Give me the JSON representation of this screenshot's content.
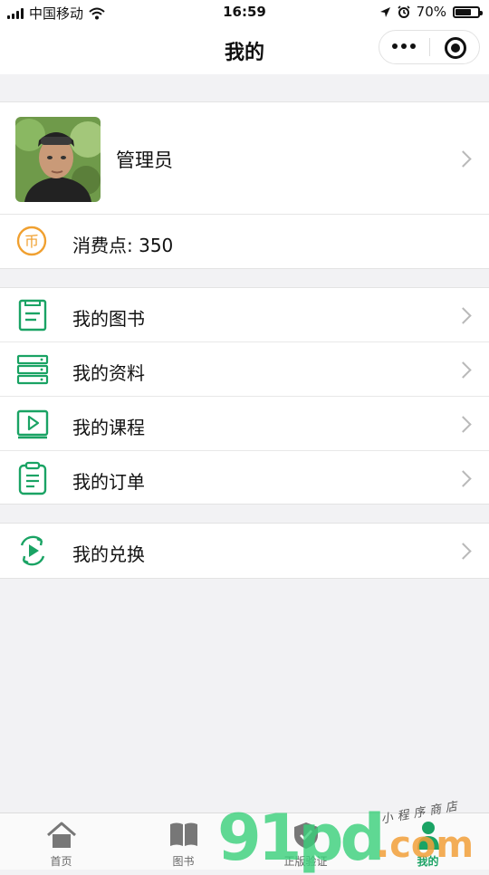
{
  "status_bar": {
    "carrier": "中国移动",
    "time": "16:59",
    "battery_percent": "70%",
    "battery_level": 0.7
  },
  "nav": {
    "title": "我的"
  },
  "profile": {
    "name": "管理员"
  },
  "points": {
    "label": "消费点: 350",
    "coin_glyph": "币"
  },
  "menu": {
    "items": [
      {
        "label": "我的图书",
        "icon": "book-icon"
      },
      {
        "label": "我的资料",
        "icon": "stack-icon"
      },
      {
        "label": "我的课程",
        "icon": "video-play-icon"
      },
      {
        "label": "我的订单",
        "icon": "clipboard-icon"
      }
    ],
    "exchange": {
      "label": "我的兑换",
      "icon": "exchange-play-icon"
    }
  },
  "tabs": [
    {
      "label": "首页",
      "icon": "home-icon",
      "active": false
    },
    {
      "label": "图书",
      "icon": "open-book-icon",
      "active": false
    },
    {
      "label": "正版验证",
      "icon": "shield-check-icon",
      "active": false
    },
    {
      "label": "我的",
      "icon": "user-icon",
      "active": true
    }
  ],
  "watermark": {
    "digits": "91pd",
    "suffix": ".com",
    "script": "小程序商店"
  },
  "colors": {
    "accent": "#1aa364",
    "coin": "#f0a030",
    "background": "#f2f2f4"
  }
}
